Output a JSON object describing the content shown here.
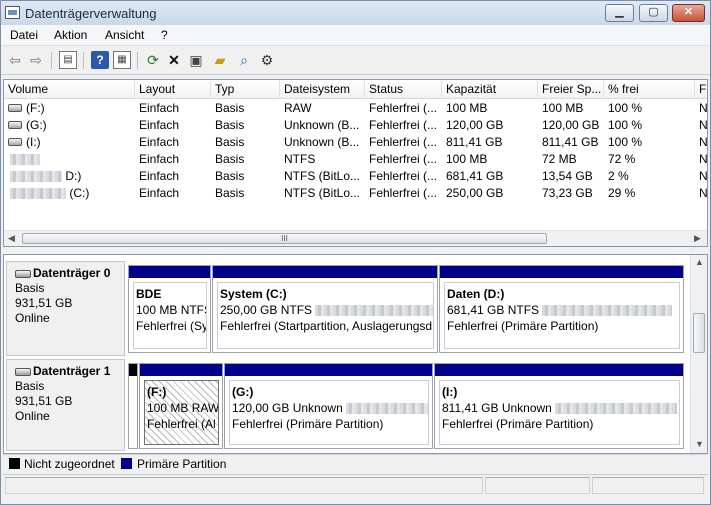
{
  "window": {
    "title": "Datenträgerverwaltung",
    "minimize": "▁",
    "maximize": "▢",
    "close": "✕"
  },
  "menu": [
    "Datei",
    "Aktion",
    "Ansicht",
    "?"
  ],
  "toolbar": {
    "back": "back-arrow",
    "forward": "forward-arrow",
    "help": "?"
  },
  "volumes": {
    "headers": [
      "Volume",
      "Layout",
      "Typ",
      "Dateisystem",
      "Status",
      "Kapazität",
      "Freier Sp...",
      "% frei",
      "F"
    ],
    "rows": [
      {
        "volume": "(F:)",
        "layout": "Einfach",
        "typ": "Basis",
        "fs": "RAW",
        "status": "Fehlerfrei (...",
        "kap": "100 MB",
        "frei": "100 MB",
        "pct": "100 %",
        "extra": "N"
      },
      {
        "volume": "(G:)",
        "layout": "Einfach",
        "typ": "Basis",
        "fs": "Unknown (B...",
        "status": "Fehlerfrei (...",
        "kap": "120,00 GB",
        "frei": "120,00 GB",
        "pct": "100 %",
        "extra": "N"
      },
      {
        "volume": "(I:)",
        "layout": "Einfach",
        "typ": "Basis",
        "fs": "Unknown (B...",
        "status": "Fehlerfrei (...",
        "kap": "811,41 GB",
        "frei": "811,41 GB",
        "pct": "100 %",
        "extra": "N"
      },
      {
        "volume": "",
        "layout": "Einfach",
        "typ": "Basis",
        "fs": "NTFS",
        "status": "Fehlerfrei (...",
        "kap": "100 MB",
        "frei": "72 MB",
        "pct": "72 %",
        "extra": "N"
      },
      {
        "volume": "D:)",
        "layout": "Einfach",
        "typ": "Basis",
        "fs": "NTFS (BitLo...",
        "status": "Fehlerfrei (...",
        "kap": "681,41 GB",
        "frei": "13,54 GB",
        "pct": "2 %",
        "extra": "N"
      },
      {
        "volume": "(C:)",
        "layout": "Einfach",
        "typ": "Basis",
        "fs": "NTFS (BitLo...",
        "status": "Fehlerfrei (...",
        "kap": "250,00 GB",
        "frei": "73,23 GB",
        "pct": "29 %",
        "extra": "N"
      }
    ],
    "scroll_grip": "III"
  },
  "disks": [
    {
      "name": "Datenträger 0",
      "type": "Basis",
      "size": "931,51 GB",
      "state": "Online",
      "partitions": [
        {
          "title": "BDE",
          "size": "100 MB NTFS",
          "status": "Fehlerfrei (Sy"
        },
        {
          "title": "System  (C:)",
          "size": "250,00 GB NTFS",
          "status": "Fehlerfrei (Startpartition, Auslagerungsd"
        },
        {
          "title": "Daten  (D:)",
          "size": "681,41 GB NTFS",
          "status": "Fehlerfrei (Primäre Partition)"
        }
      ]
    },
    {
      "name": "Datenträger 1",
      "type": "Basis",
      "size": "931,51 GB",
      "state": "Online",
      "partitions": [
        {
          "title": "(F:)",
          "size": "100 MB RAW",
          "status": "Fehlerfrei (Al"
        },
        {
          "title": "(G:)",
          "size": "120,00 GB Unknown",
          "status": "Fehlerfrei (Primäre Partition)"
        },
        {
          "title": "(I:)",
          "size": "811,41 GB Unknown",
          "status": "Fehlerfrei (Primäre Partition)"
        }
      ]
    }
  ],
  "legend": {
    "unallocated": "Nicht zugeordnet",
    "primary": "Primäre Partition",
    "unallocated_color": "#000000",
    "primary_color": "#00008b"
  }
}
